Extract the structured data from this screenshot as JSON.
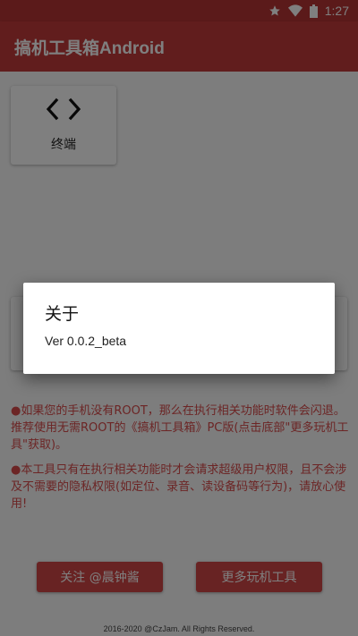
{
  "status_bar": {
    "time": "1:27",
    "icons": [
      "star-icon",
      "wifi-icon",
      "battery-icon"
    ]
  },
  "app_bar": {
    "title": "搞机工具箱Android"
  },
  "tiles": [
    {
      "label": "终端",
      "icon": "code-icon"
    }
  ],
  "notes": [
    "●如果您的手机没有ROOT，那么在执行相关功能时软件会闪退。推荐使用无需ROOT的《搞机工具箱》PC版(点击底部\"更多玩机工具\"获取)。",
    "●本工具只有在执行相关功能时才会请求超级用户权限，且不会涉及不需要的隐私权限(如定位、录音、读设备码等行为)，请放心使用!"
  ],
  "buttons": {
    "follow": "关注 @晨钟酱",
    "more_tools": "更多玩机工具"
  },
  "footer": "2016-2020 @CzJam. All Rights Reserved.",
  "dialog": {
    "title": "关于",
    "message": "Ver 0.0.2_beta"
  },
  "colors": {
    "primary": "#c33b3b",
    "status_bar": "#b73535",
    "note_text": "#d84a4a",
    "button": "#d04646"
  }
}
